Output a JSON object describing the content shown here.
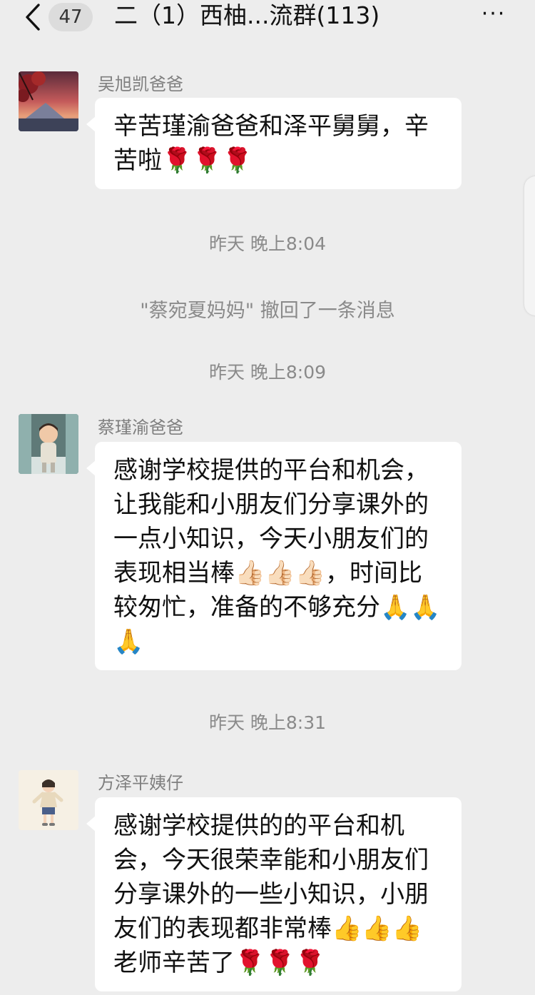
{
  "header": {
    "unread_count": "47",
    "title": "二（1）西柚...流群(113)",
    "more_glyph": "···"
  },
  "messages": [
    {
      "type": "message",
      "sender": "吴旭凯爸爸",
      "avatar": "sunset-landscape-avatar",
      "text": "辛苦瑾渝爸爸和泽平舅舅，辛苦啦🌹🌹🌹"
    },
    {
      "type": "time",
      "text": "昨天 晚上8:04"
    },
    {
      "type": "system",
      "text": "\"蔡宛夏妈妈\" 撤回了一条消息"
    },
    {
      "type": "time",
      "text": "昨天 晚上8:09"
    },
    {
      "type": "message",
      "sender": "蔡瑾渝爸爸",
      "avatar": "cartoon-boy-avatar",
      "text": "感谢学校提供的平台和机会，让我能和小朋友们分享课外的一点小知识，今天小朋友们的表现相当棒👍🏻👍🏻👍🏻，时间比较匆忙，准备的不够充分🙏🙏🙏"
    },
    {
      "type": "time",
      "text": "昨天 晚上8:31"
    },
    {
      "type": "message",
      "sender": "方泽平姨仔",
      "avatar": "cartoon-girl-avatar",
      "text": "感谢学校提供的的平台和机会，今天很荣幸能和小朋友们分享课外的一些小知识，小朋友们的表现都非常棒👍👍👍老师辛苦了🌹🌹🌹"
    }
  ]
}
